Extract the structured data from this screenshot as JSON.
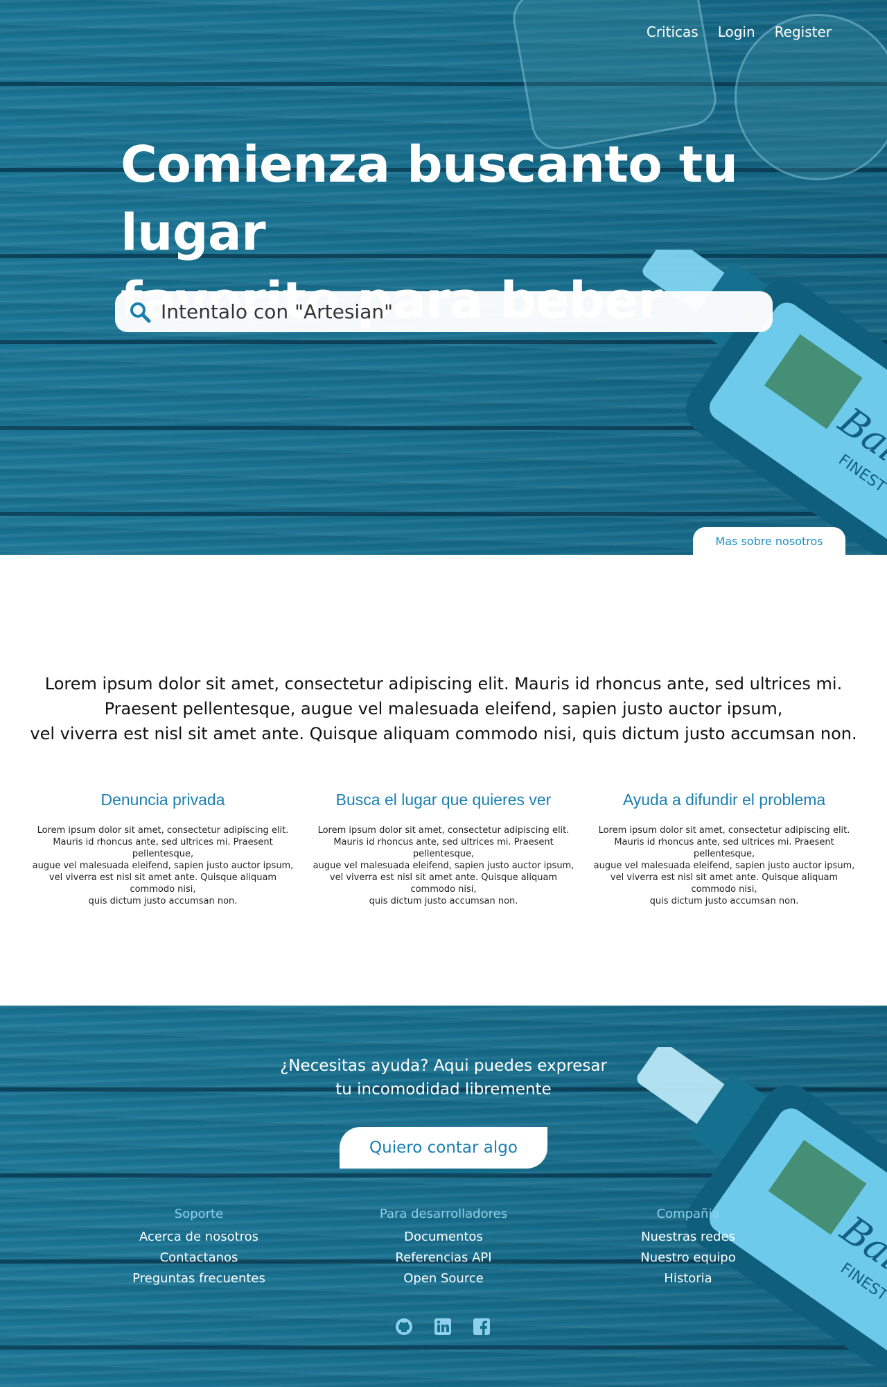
{
  "nav": {
    "items": [
      "Criticas",
      "Login",
      "Register"
    ]
  },
  "hero": {
    "title_line1": "Comienza buscanto tu lugar",
    "title_line2": "favorito para beber",
    "search_placeholder": "Intentalo con \"Artesian\"",
    "more_button": "Mas sobre nosotros"
  },
  "intro": {
    "line1": "Lorem ipsum dolor sit amet, consectetur adipiscing elit. Mauris id rhoncus ante, sed ultrices mi.",
    "line2": "Praesent pellentesque, augue vel malesuada eleifend, sapien justo auctor ipsum,",
    "line3": "vel viverra est nisl sit amet ante. Quisque aliquam commodo nisi, quis dictum justo accumsan non."
  },
  "features": [
    {
      "title": "Denuncia privada",
      "lines": [
        "Lorem ipsum dolor sit amet, consectetur adipiscing elit.",
        "Mauris id rhoncus ante, sed ultrices mi. Praesent pellentesque,",
        "augue vel malesuada eleifend, sapien justo auctor ipsum,",
        "vel viverra est nisl sit amet ante. Quisque aliquam commodo nisi,",
        "quis dictum justo accumsan non."
      ]
    },
    {
      "title": "Busca el lugar que quieres ver",
      "lines": [
        "Lorem ipsum dolor sit amet, consectetur adipiscing elit.",
        "Mauris id rhoncus ante, sed ultrices mi. Praesent pellentesque,",
        "augue vel malesuada eleifend, sapien justo auctor ipsum,",
        "vel viverra est nisl sit amet ante. Quisque aliquam commodo nisi,",
        "quis dictum justo accumsan non."
      ]
    },
    {
      "title": "Ayuda a difundir el problema",
      "lines": [
        "Lorem ipsum dolor sit amet, consectetur adipiscing elit.",
        "Mauris id rhoncus ante, sed ultrices mi. Praesent pellentesque,",
        "augue vel malesuada eleifend, sapien justo auctor ipsum,",
        "vel viverra est nisl sit amet ante. Quisque aliquam commodo nisi,",
        "quis dictum justo accumsan non."
      ]
    }
  ],
  "footer": {
    "help_line1": "¿Necesitas ayuda? Aqui puedes expresar",
    "help_line2": "tu incomodidad libremente",
    "cta": "Quiero contar algo",
    "columns": [
      {
        "heading": "Soporte",
        "links": [
          "Acerca de nosotros",
          "Contactanos",
          "Preguntas frecuentes"
        ]
      },
      {
        "heading": "Para desarrolladores",
        "links": [
          "Documentos",
          "Referencias API",
          "Open Source"
        ]
      },
      {
        "heading": "Compañia",
        "links": [
          "Nuestras redes",
          "Nuestro equipo",
          "Historia"
        ]
      }
    ],
    "social_icons": [
      "github-icon",
      "linkedin-icon",
      "facebook-icon"
    ]
  },
  "colors": {
    "overlay": "#15708f",
    "accent": "#1a7fb0",
    "link_light": "#8fd0ea"
  }
}
